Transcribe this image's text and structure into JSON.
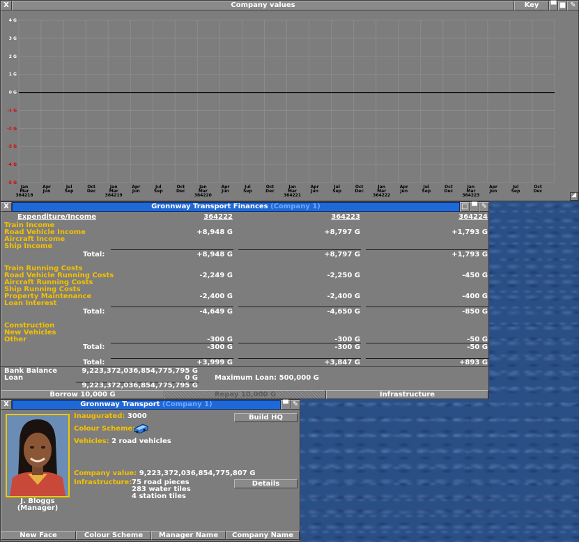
{
  "graph_window": {
    "close_glyph": "X",
    "title": "Company values",
    "key_label": "Key",
    "y_ticks": [
      "4 G",
      "3 G",
      "2 G",
      "1 G",
      "0 G",
      "-1 G",
      "-2 G",
      "-3 G",
      "-4 G",
      "-5 G"
    ],
    "x_ticks": [
      {
        "m1": "Jan",
        "m2": "Mar",
        "year": "364218"
      },
      {
        "m1": "Apr",
        "m2": "Jun",
        "year": ""
      },
      {
        "m1": "Jul",
        "m2": "Sep",
        "year": ""
      },
      {
        "m1": "Oct",
        "m2": "Dec",
        "year": ""
      },
      {
        "m1": "Jan",
        "m2": "Mar",
        "year": "364219"
      },
      {
        "m1": "Apr",
        "m2": "Jun",
        "year": ""
      },
      {
        "m1": "Jul",
        "m2": "Sep",
        "year": ""
      },
      {
        "m1": "Oct",
        "m2": "Dec",
        "year": ""
      },
      {
        "m1": "Jan",
        "m2": "Mar",
        "year": "364220"
      },
      {
        "m1": "Apr",
        "m2": "Jun",
        "year": ""
      },
      {
        "m1": "Jul",
        "m2": "Sep",
        "year": ""
      },
      {
        "m1": "Oct",
        "m2": "Dec",
        "year": ""
      },
      {
        "m1": "Jan",
        "m2": "Mar",
        "year": "364221"
      },
      {
        "m1": "Apr",
        "m2": "Jun",
        "year": ""
      },
      {
        "m1": "Jul",
        "m2": "Sep",
        "year": ""
      },
      {
        "m1": "Oct",
        "m2": "Dec",
        "year": ""
      },
      {
        "m1": "Jan",
        "m2": "Mar",
        "year": "364222"
      },
      {
        "m1": "Apr",
        "m2": "Jun",
        "year": ""
      },
      {
        "m1": "Jul",
        "m2": "Sep",
        "year": ""
      },
      {
        "m1": "Oct",
        "m2": "Dec",
        "year": ""
      },
      {
        "m1": "Jan",
        "m2": "Mar",
        "year": "364223"
      },
      {
        "m1": "Apr",
        "m2": "Jun",
        "year": ""
      },
      {
        "m1": "Jul",
        "m2": "Sep",
        "year": ""
      },
      {
        "m1": "Oct",
        "m2": "Dec",
        "year": ""
      }
    ]
  },
  "chart_data": {
    "type": "line",
    "title": "Company values",
    "ylim": [
      -5,
      4
    ],
    "yunit": "G",
    "grid": true,
    "series": [
      {
        "values": [
          0,
          0,
          0,
          0,
          0,
          0,
          0,
          0,
          0,
          0,
          0,
          0,
          0,
          0,
          0,
          0,
          0,
          0,
          0,
          0,
          0,
          0,
          0,
          0,
          0
        ]
      }
    ],
    "colors": {
      "zero_line": "#000000",
      "negative_tick": "#e00000",
      "positive_tick": "#ffffff",
      "grid": "#8c8c8c",
      "plot_bg": "#7d7d7d"
    }
  },
  "finances_window": {
    "close_glyph": "X",
    "title_name": "Gronnway Transport Finances",
    "title_company": "(Company 1)",
    "header_label": "Expenditure/Income",
    "years": [
      "364222",
      "364223",
      "364224"
    ],
    "income_labels": [
      "Train Income",
      "Road Vehicle Income",
      "Aircraft Income",
      "Ship Income"
    ],
    "income_values": [
      "+8,948 G",
      "+8,797 G",
      "+1,793 G"
    ],
    "total_label": "Total:",
    "income_totals": [
      "+8,948 G",
      "+8,797 G",
      "+1,793 G"
    ],
    "cost_labels": [
      "Train Running Costs",
      "Road Vehicle Running Costs",
      "Aircraft Running Costs",
      "Ship Running Costs",
      "Property Maintenance",
      "Loan Interest"
    ],
    "road_running": [
      "-2,249 G",
      "-2,250 G",
      "-450 G"
    ],
    "property": [
      "-2,400 G",
      "-2,400 G",
      "-400 G"
    ],
    "cost_totals": [
      "-4,649 G",
      "-4,650 G",
      "-850 G"
    ],
    "capital_labels": [
      "Construction",
      "New Vehicles",
      "Other"
    ],
    "other_values": [
      "-300 G",
      "-300 G",
      "-50 G"
    ],
    "capital_totals": [
      "-300 G",
      "-300 G",
      "-50 G"
    ],
    "grand_totals": [
      "+3,999 G",
      "+3,847 G",
      "+893 G"
    ],
    "bank_balance_label": "Bank Balance",
    "bank_balance": "9,223,372,036,854,775,795 G",
    "loan_label": "Loan",
    "loan": "0 G",
    "net": "9,223,372,036,854,775,795 G",
    "max_loan_label": "Maximum Loan:",
    "max_loan": "500,000 G",
    "borrow_label": "Borrow 10,000 G",
    "repay_label": "Repay 10,000 G",
    "infrastructure_label": "Infrastructure"
  },
  "company_window": {
    "close_glyph": "X",
    "title_name": "Gronnway Transport",
    "title_company": "(Company 1)",
    "manager_name": "J. Bloggs",
    "manager_role": "(Manager)",
    "inaugurated_label": "Inaugurated:",
    "inaugurated": "3000",
    "colour_scheme_label": "Colour Scheme:",
    "vehicles_label": "Vehicles:",
    "vehicles": "2 road vehicles",
    "company_value_label": "Company value:",
    "company_value": "9,223,372,036,854,775,807 G",
    "infrastructure_label": "Infrastructure:",
    "infra_road": "75 road pieces",
    "infra_water": "283 water tiles",
    "infra_station": "4 station tiles",
    "build_hq_label": "Build HQ",
    "details_label": "Details",
    "new_face_label": "New Face",
    "colour_scheme_button": "Colour Scheme",
    "manager_name_button": "Manager Name",
    "company_name_button": "Company Name",
    "colors": {
      "company_colour": "#2f7de0"
    }
  }
}
